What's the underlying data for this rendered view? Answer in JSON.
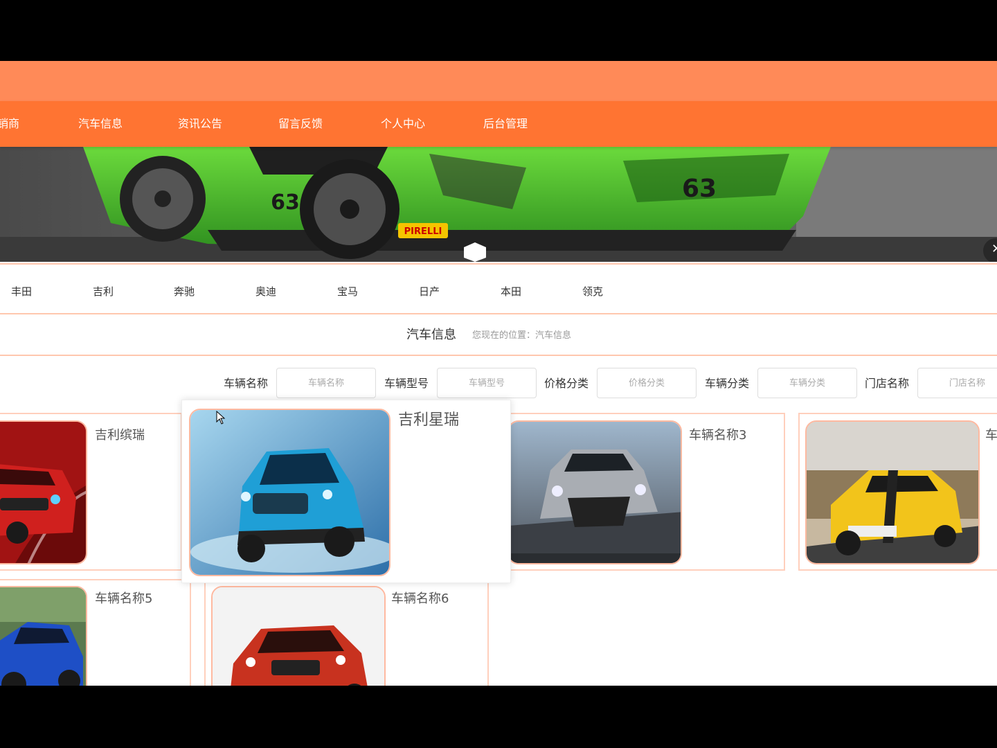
{
  "nav": {
    "items": [
      {
        "label": "销商"
      },
      {
        "label": "汽车信息"
      },
      {
        "label": "资讯公告"
      },
      {
        "label": "留言反馈"
      },
      {
        "label": "个人中心"
      },
      {
        "label": "后台管理"
      }
    ]
  },
  "banner": {
    "plate_text": "63",
    "sponsor_text": "PIRELLI",
    "next_icon": "close-icon",
    "colors": {
      "car": "#3CB52A",
      "active_dot": "#FF7432"
    }
  },
  "brands": [
    "丰田",
    "吉利",
    "奔驰",
    "奥迪",
    "宝马",
    "日产",
    "本田",
    "领克"
  ],
  "page": {
    "title": "汽车信息",
    "breadcrumb": "您现在的位置：汽车信息"
  },
  "filters": [
    {
      "label": "车辆名称",
      "placeholder": "车辆名称"
    },
    {
      "label": "车辆型号",
      "placeholder": "车辆型号"
    },
    {
      "label": "价格分类",
      "placeholder": "价格分类"
    },
    {
      "label": "车辆分类",
      "placeholder": "车辆分类"
    },
    {
      "label": "门店名称",
      "placeholder": "门店名称"
    }
  ],
  "cars": [
    {
      "name": "吉利缤瑞",
      "color": "#D0201E"
    },
    {
      "name": "吉利星瑞",
      "color": "#1F9FD6"
    },
    {
      "name": "车辆名称3",
      "color": "#A9ADB3"
    },
    {
      "name": "车",
      "color": "#F2C41B"
    },
    {
      "name": "车辆名称5",
      "color": "#1E4FC6"
    },
    {
      "name": "车辆名称6",
      "color": "#C8321F"
    }
  ],
  "theme": {
    "primary": "#FF7432",
    "top_bar": "#FF8A58",
    "border": "#FFC7AE"
  }
}
